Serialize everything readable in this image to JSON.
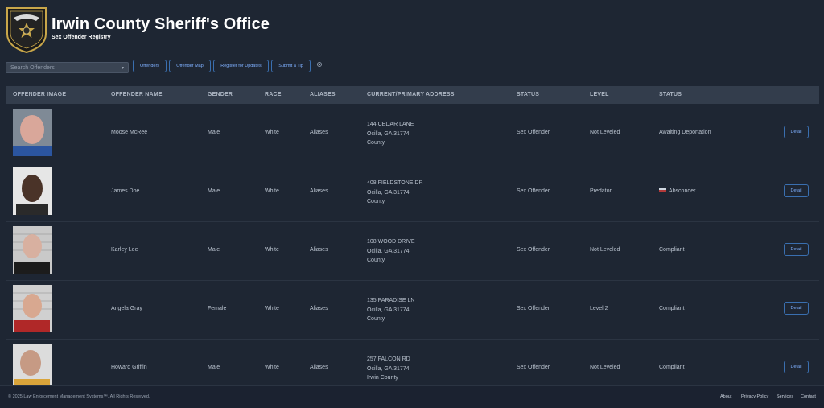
{
  "header": {
    "title": "Irwin County Sheriff's Office",
    "subtitle": "Sex Offender Registry",
    "logo_icon": "sheriff-badge-icon"
  },
  "toolbar": {
    "search_placeholder": "Search Offenders",
    "buttons": [
      "Offenders",
      "Offender Map",
      "Register for Updates",
      "Submit a Tip"
    ]
  },
  "table": {
    "headers": [
      "OFFENDER IMAGE",
      "OFFENDER NAME",
      "GENDER",
      "RACE",
      "ALIASES",
      "CURRENT/PRIMARY ADDRESS",
      "STATUS",
      "LEVEL",
      "STATUS"
    ],
    "rows": [
      {
        "name": "Moose McRee",
        "gender": "Male",
        "race": "White",
        "aliases": "Aliases",
        "addr1": "144 CEDAR LANE",
        "addr2": "Ocilla, GA 31774",
        "addr3": "County",
        "status": "Sex Offender",
        "level": "Not Leveled",
        "status2": "Awaiting Deportation",
        "flag": false,
        "detail": "Detail"
      },
      {
        "name": "James Doe",
        "gender": "Male",
        "race": "White",
        "aliases": "Aliases",
        "addr1": "408 FIELDSTONE DR",
        "addr2": "Ocilla, GA 31774",
        "addr3": "County",
        "status": "Sex Offender",
        "level": "Predator",
        "status2": "Absconder",
        "flag": true,
        "detail": "Detail"
      },
      {
        "name": "Karley Lee",
        "gender": "Male",
        "race": "White",
        "aliases": "Aliases",
        "addr1": "108 WOOD DRIVE",
        "addr2": "Ocilla, GA 31774",
        "addr3": "County",
        "status": "Sex Offender",
        "level": "Not Leveled",
        "status2": "Compliant",
        "flag": false,
        "detail": "Detail"
      },
      {
        "name": "Angela Gray",
        "gender": "Female",
        "race": "White",
        "aliases": "Aliases",
        "addr1": "135 PARADISE LN",
        "addr2": "Ocilla, GA 31774",
        "addr3": "County",
        "status": "Sex Offender",
        "level": "Level 2",
        "status2": "Compliant",
        "flag": false,
        "detail": "Detail"
      },
      {
        "name": "Howard Griffin",
        "gender": "Male",
        "race": "White",
        "aliases": "Aliases",
        "addr1": "257 FALCON RD",
        "addr2": "Ocilla, GA 31774",
        "addr3": "Irwin County",
        "status": "Sex Offender",
        "level": "Not Leveled",
        "status2": "Compliant",
        "flag": false,
        "detail": "Detail"
      }
    ]
  },
  "footer": {
    "copyright": "© 2025 Law Enforcement Management Systems™. All Rights Reserved.",
    "links": [
      "About",
      "Privacy Policy",
      "Services",
      "Contact"
    ]
  },
  "colors": {
    "background": "#1e2633",
    "accent": "#3a6fb0",
    "header_row": "#333d4c"
  }
}
